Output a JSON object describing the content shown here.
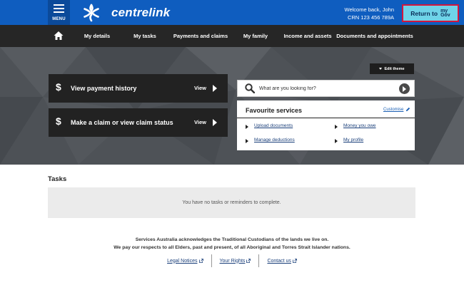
{
  "header": {
    "menu_label": "MENU",
    "logo_text": "centrelink",
    "welcome_line": "Welcome back, John",
    "crn_line": "CRN 123 456 789A",
    "return_label": "Return to",
    "mygov_line1": "my",
    "mygov_line2": "Gov",
    "color_primary": "#0f5dbf",
    "color_return_button": "#6fd3e8"
  },
  "nav": {
    "home_icon": "home-icon",
    "items": [
      {
        "label": "My details"
      },
      {
        "label": "My tasks"
      },
      {
        "label": "Payments and claims"
      },
      {
        "label": "My family"
      },
      {
        "label": "Income and assets"
      },
      {
        "label": "Documents and appointments"
      }
    ]
  },
  "hero": {
    "edit_theme_label": "Edit theme",
    "tiles": [
      {
        "label": "View payment history",
        "action": "View"
      },
      {
        "label": "Make a claim or view claim status",
        "action": "View"
      }
    ],
    "search": {
      "placeholder": "What are you looking for?"
    },
    "favourites": {
      "title": "Favourite services",
      "customise_label": "Customise",
      "links": [
        {
          "label": "Upload documents"
        },
        {
          "label": "Money you owe"
        },
        {
          "label": "Manage deductions"
        },
        {
          "label": "My profile"
        }
      ]
    }
  },
  "tasks": {
    "heading": "Tasks",
    "empty_message": "You have no tasks or reminders to complete."
  },
  "footer": {
    "ack_line1": "Services Australia acknowledges the Traditional Custodians of the lands we live on.",
    "ack_line2": "We pay our respects to all Elders, past and present, of all Aboriginal and Torres Strait Islander nations.",
    "links": [
      {
        "label": "Legal Notices"
      },
      {
        "label": "Your Rights"
      },
      {
        "label": "Contact us"
      }
    ]
  }
}
